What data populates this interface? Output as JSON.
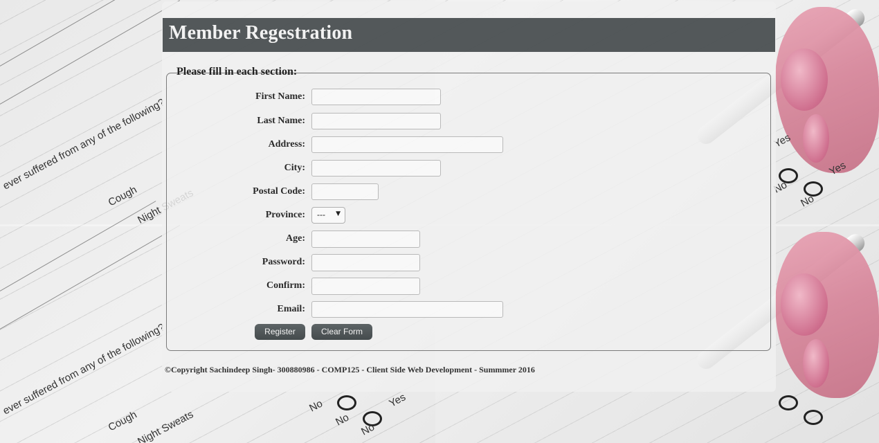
{
  "header": {
    "title": "Member Regestration"
  },
  "form": {
    "legend": "Please fill in each section:",
    "fields": {
      "first_name": {
        "label": "First Name:",
        "value": ""
      },
      "last_name": {
        "label": "Last Name:",
        "value": ""
      },
      "address": {
        "label": "Address:",
        "value": ""
      },
      "city": {
        "label": "City:",
        "value": ""
      },
      "postal_code": {
        "label": "Postal Code:",
        "value": ""
      },
      "province": {
        "label": "Province:",
        "selected": "---"
      },
      "age": {
        "label": "Age:",
        "value": ""
      },
      "password": {
        "label": "Password:",
        "value": ""
      },
      "confirm": {
        "label": "Confirm:",
        "value": ""
      },
      "email": {
        "label": "Email:",
        "value": ""
      }
    },
    "buttons": {
      "register": "Register",
      "clear": "Clear Form"
    }
  },
  "footer": {
    "copyright": "©Copyright Sachindeep Singh- 300880986 - COMP125 - Client Side Web Development - Summmer 2016"
  },
  "background": {
    "words": [
      "Yes",
      "No",
      "Yes",
      "No",
      "Cough",
      "Night Sweats",
      "No",
      "Yes"
    ],
    "question": "ever suffered from any of the following?"
  }
}
